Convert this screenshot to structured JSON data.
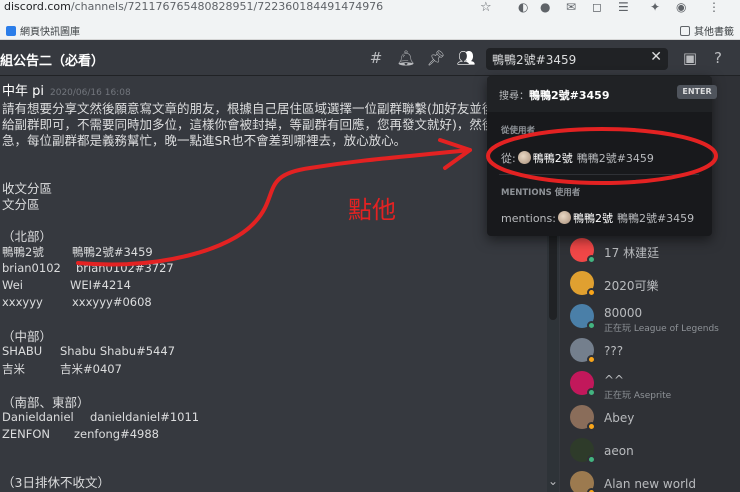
{
  "browser": {
    "url_domain": "discord.com",
    "url_path": "/channels/721176765480828951/722360184491474976",
    "bookmark_left": "網頁快訊圖庫",
    "bookmark_right": "其他書籤"
  },
  "channel": {
    "name": "組公告二（必看）"
  },
  "search": {
    "value": "鴨鴨2號#3459",
    "clear_symbol": "✕"
  },
  "message": {
    "author": "中年 pi",
    "timestamp": "2020/06/16 16:08",
    "lines": [
      "請有想要分享文然後願意寫文章的朋友，根據自己居住區域選擇一位副群聯繫(加好友並後",
      "給副群即可，不需要同時加多位，這樣你會被封掉，等副群有回應，您再發文就好)，然後不",
      "急，每位副群都是義務幫忙，晚一點進SR也不會差到哪裡去，放心放心。",
      "收文分區",
      "文分區",
      "（北部）",
      "（中部）",
      "（南部、東部）",
      "（3日排休不收文）"
    ],
    "contacts": [
      {
        "name": "鴨鴨2號",
        "tag": "鴨鴨2號#3459"
      },
      {
        "name": "brian0102",
        "tag": "brian0102#3727"
      },
      {
        "name": "Wei",
        "tag": "WEI#4214"
      },
      {
        "name": "xxxyyy",
        "tag": "xxxyyy#0608"
      },
      {
        "name": "SHABU",
        "tag": "Shabu Shabu#5447"
      },
      {
        "name": "吉米",
        "tag": "吉米#0407"
      },
      {
        "name": "Danieldaniel",
        "tag": "danieldaniel#1011"
      },
      {
        "name": "ZENFON",
        "tag": "zenfong#4988"
      }
    ]
  },
  "popout": {
    "search_prefix": "搜尋：",
    "search_value": "鴨鴨2號#3459",
    "enter_label": "ENTER",
    "from_section": "從使用者",
    "from_prefix": "從:",
    "from_name": "鴨鴨2號",
    "from_tag": "鴨鴨2號#3459",
    "mentions_section": "MENTIONS 使用者",
    "mentions_prefix": "mentions:",
    "mentions_name": "鴨鴨2號",
    "mentions_tag": "鴨鴨2號#3459"
  },
  "annotation": {
    "text": "點他",
    "color": "#e32222"
  },
  "members": [
    {
      "name": "17 林建廷",
      "activity": "",
      "status": "online",
      "avatar_color": "#f04747"
    },
    {
      "name": "2020可樂",
      "activity": "",
      "status": "idle",
      "avatar_color": "#e0a030"
    },
    {
      "name": "80000",
      "activity": "正在玩 League of Legends",
      "status": "online",
      "avatar_color": "#4a7fa8"
    },
    {
      "name": "???",
      "activity": "",
      "status": "idle",
      "avatar_color": "#747f8d"
    },
    {
      "name": "^^",
      "activity": "正在玩 Aseprite",
      "status": "online",
      "avatar_color": "#c2185b"
    },
    {
      "name": "Abey",
      "activity": "",
      "status": "idle",
      "avatar_color": "#8a6d5a"
    },
    {
      "name": "aeon",
      "activity": "",
      "status": "online",
      "avatar_color": "#2e3b2a"
    },
    {
      "name": "Alan new world",
      "activity": "",
      "status": "idle",
      "avatar_color": "#9c7a4f"
    }
  ],
  "colors": {
    "background": "#36393f",
    "sidebar": "#2f3136",
    "popout": "#18191c",
    "online": "#43b581",
    "idle": "#faa61a"
  }
}
